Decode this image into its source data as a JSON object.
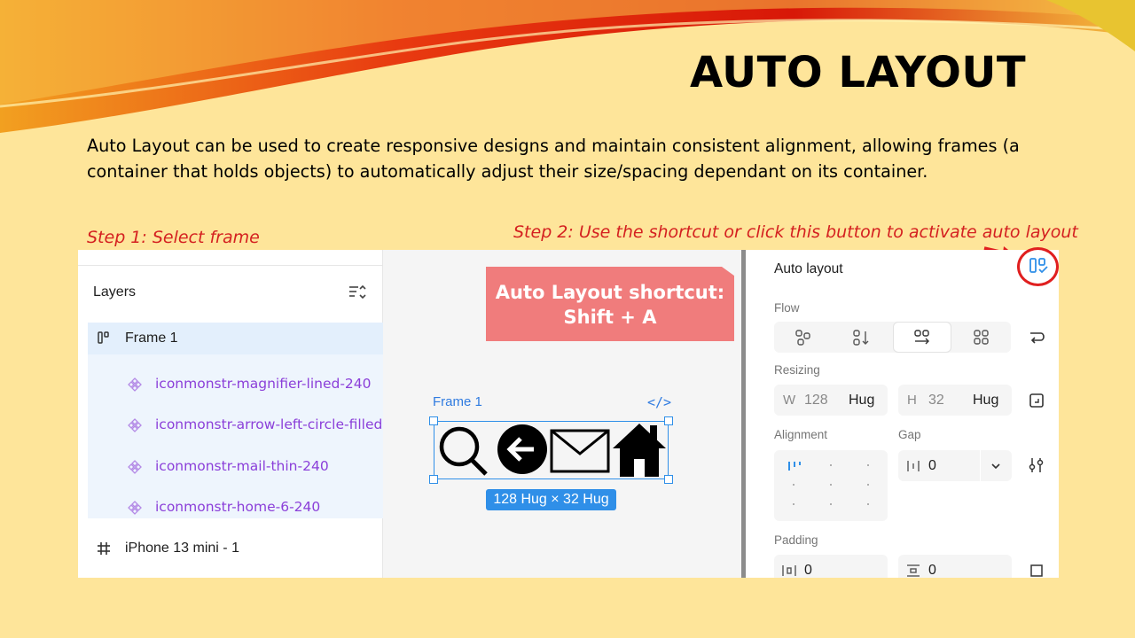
{
  "slide": {
    "title": "AUTO LAYOUT",
    "body": "Auto Layout can be used to create responsive designs and maintain consistent alignment, allowing frames (a container that holds objects) to automatically adjust their size/spacing dependant on its container.",
    "step1": "Step 1:  Select frame",
    "step2": "Step 2:  Use the shortcut or click this button to activate auto layout"
  },
  "layers": {
    "title": "Layers",
    "frame": "Frame 1",
    "children": [
      "iconmonstr-magnifier-lined-240",
      "iconmonstr-arrow-left-circle-filled",
      "iconmonstr-mail-thin-240",
      "iconmonstr-home-6-240"
    ],
    "iphone": "iPhone 13 mini - 1"
  },
  "canvas": {
    "shortcut_line1": "Auto Layout shortcut:",
    "shortcut_line2": "Shift + A",
    "frame_label": "Frame 1",
    "code_icon": "</>",
    "size_badge": "128 Hug × 32 Hug"
  },
  "props": {
    "title": "Auto layout",
    "flow_label": "Flow",
    "resizing_label": "Resizing",
    "width_prefix": "W",
    "width_value": "128",
    "width_mode": "Hug",
    "height_prefix": "H",
    "height_value": "32",
    "height_mode": "Hug",
    "alignment_label": "Alignment",
    "gap_label": "Gap",
    "gap_value": "0",
    "padding_label": "Padding",
    "padding_h": "0",
    "padding_v": "0"
  },
  "colors": {
    "slide_bg": "#FEE59A",
    "step_red": "#D42020",
    "selection_blue": "#2F8FE8",
    "layer_purple": "#8B3FD9",
    "shortcut_bg": "#F07C7C"
  }
}
